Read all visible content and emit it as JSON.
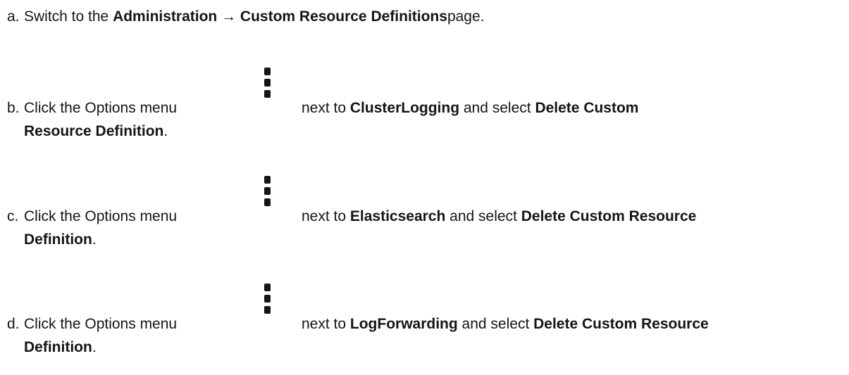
{
  "steps": [
    {
      "marker": "a.",
      "prefix": "Switch to the ",
      "bold": "Administration → Custom Resource Definitions",
      "suffix": "page."
    },
    {
      "marker": "b.",
      "prefix": "Click the Options menu",
      "icon": "kebab-icon",
      "mid": "next to ",
      "resource": "ClusterLogging",
      "and": " and select ",
      "action_line1": "Delete Custom",
      "action_line2": "Resource Definition",
      "end": "."
    },
    {
      "marker": "c.",
      "prefix": "Click the Options menu",
      "icon": "kebab-icon",
      "mid": "next to ",
      "resource": "Elasticsearch",
      "and": " and select ",
      "action_line1": "Delete Custom Resource",
      "action_line2": "Definition",
      "end": "."
    },
    {
      "marker": "d.",
      "prefix": "Click the Options menu",
      "icon": "kebab-icon",
      "mid": "next to ",
      "resource": "LogForwarding",
      "and": " and select ",
      "action_line1": "Delete Custom Resource",
      "action_line2": "Definition",
      "end": "."
    }
  ]
}
